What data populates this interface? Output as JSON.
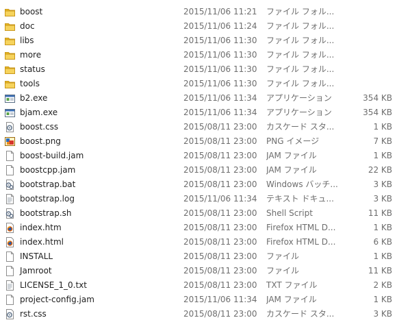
{
  "files": [
    {
      "name": "boost",
      "date": "2015/11/06 11:21",
      "type": "ファイル フォル...",
      "size": "",
      "icon": "folder-icon"
    },
    {
      "name": "doc",
      "date": "2015/11/06 11:24",
      "type": "ファイル フォル...",
      "size": "",
      "icon": "folder-icon"
    },
    {
      "name": "libs",
      "date": "2015/11/06 11:30",
      "type": "ファイル フォル...",
      "size": "",
      "icon": "folder-icon"
    },
    {
      "name": "more",
      "date": "2015/11/06 11:30",
      "type": "ファイル フォル...",
      "size": "",
      "icon": "folder-icon"
    },
    {
      "name": "status",
      "date": "2015/11/06 11:30",
      "type": "ファイル フォル...",
      "size": "",
      "icon": "folder-icon"
    },
    {
      "name": "tools",
      "date": "2015/11/06 11:30",
      "type": "ファイル フォル...",
      "size": "",
      "icon": "folder-icon"
    },
    {
      "name": "b2.exe",
      "date": "2015/11/06 11:34",
      "type": "アプリケーション",
      "size": "354 KB",
      "icon": "exe-icon"
    },
    {
      "name": "bjam.exe",
      "date": "2015/11/06 11:34",
      "type": "アプリケーション",
      "size": "354 KB",
      "icon": "exe-icon"
    },
    {
      "name": "boost.css",
      "date": "2015/08/11 23:00",
      "type": "カスケード スタ...",
      "size": "1 KB",
      "icon": "css-icon"
    },
    {
      "name": "boost.png",
      "date": "2015/08/11 23:00",
      "type": "PNG イメージ",
      "size": "7 KB",
      "icon": "png-icon"
    },
    {
      "name": "boost-build.jam",
      "date": "2015/08/11 23:00",
      "type": "JAM ファイル",
      "size": "1 KB",
      "icon": "file-icon"
    },
    {
      "name": "boostcpp.jam",
      "date": "2015/08/11 23:00",
      "type": "JAM ファイル",
      "size": "22 KB",
      "icon": "file-icon"
    },
    {
      "name": "bootstrap.bat",
      "date": "2015/08/11 23:00",
      "type": "Windows バッチ...",
      "size": "3 KB",
      "icon": "script-icon"
    },
    {
      "name": "bootstrap.log",
      "date": "2015/11/06 11:34",
      "type": "テキスト ドキュ...",
      "size": "3 KB",
      "icon": "text-icon"
    },
    {
      "name": "bootstrap.sh",
      "date": "2015/08/11 23:00",
      "type": "Shell Script",
      "size": "11 KB",
      "icon": "script-icon"
    },
    {
      "name": "index.htm",
      "date": "2015/08/11 23:00",
      "type": "Firefox HTML D...",
      "size": "1 KB",
      "icon": "html-icon"
    },
    {
      "name": "index.html",
      "date": "2015/08/11 23:00",
      "type": "Firefox HTML D...",
      "size": "6 KB",
      "icon": "html-icon"
    },
    {
      "name": "INSTALL",
      "date": "2015/08/11 23:00",
      "type": "ファイル",
      "size": "1 KB",
      "icon": "file-icon"
    },
    {
      "name": "Jamroot",
      "date": "2015/08/11 23:00",
      "type": "ファイル",
      "size": "11 KB",
      "icon": "file-icon"
    },
    {
      "name": "LICENSE_1_0.txt",
      "date": "2015/08/11 23:00",
      "type": "TXT ファイル",
      "size": "2 KB",
      "icon": "text-icon"
    },
    {
      "name": "project-config.jam",
      "date": "2015/11/06 11:34",
      "type": "JAM ファイル",
      "size": "1 KB",
      "icon": "file-icon"
    },
    {
      "name": "rst.css",
      "date": "2015/08/11 23:00",
      "type": "カスケード スタ...",
      "size": "3 KB",
      "icon": "css-icon"
    }
  ]
}
